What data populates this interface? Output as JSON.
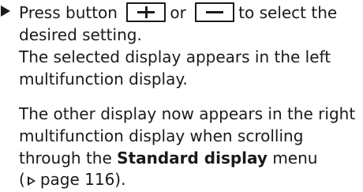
{
  "step": {
    "line1_before": "Press button",
    "or": "or",
    "line1_after": "to select the",
    "line2": "desired setting.",
    "line3": "The selected display appears in the left",
    "line4": "multifunction display."
  },
  "keys": {
    "plus_icon": "plus-icon",
    "minus_icon": "minus-icon"
  },
  "note": {
    "line1": "The other display now appears in the right",
    "line2": "multifunction display when scrolling",
    "line3_before": "through the",
    "menu_name": "Standard display",
    "line3_after": "menu",
    "ref_open": "(",
    "ref_icon": "page-reference-triangle-icon",
    "ref_text": "page 116).",
    "ref_page": 116
  }
}
